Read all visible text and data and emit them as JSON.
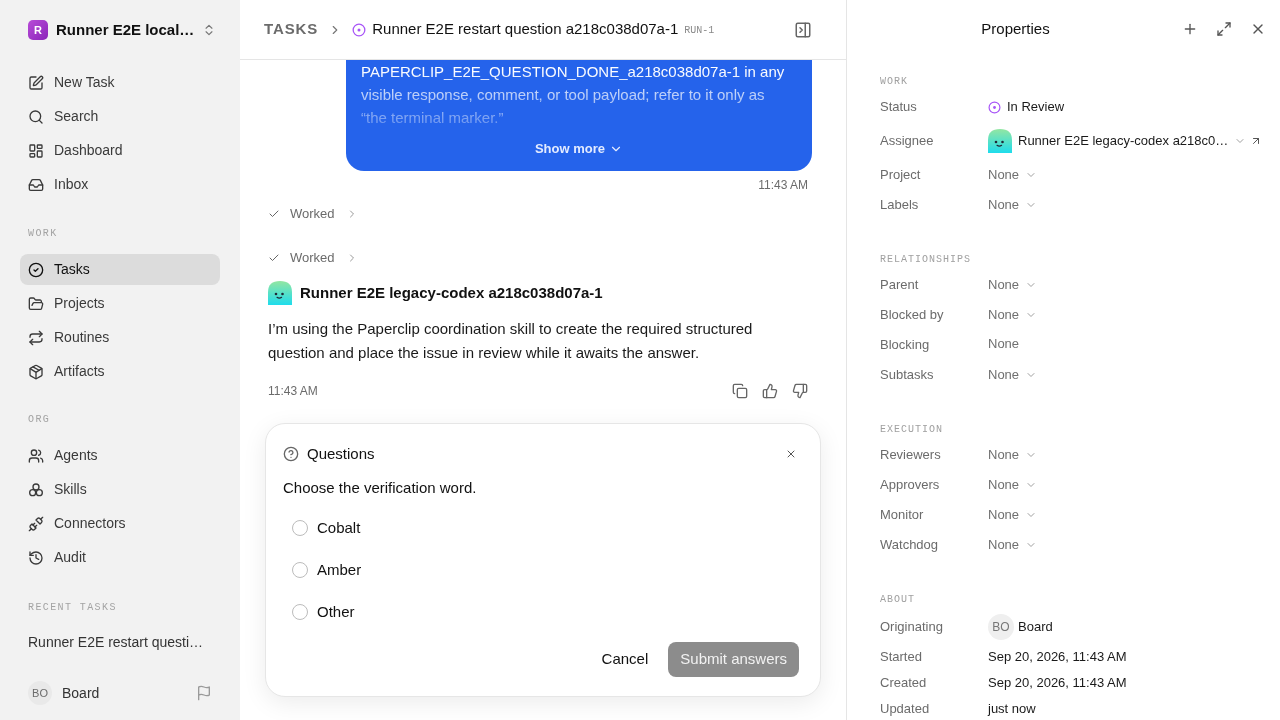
{
  "sidebar": {
    "workspace": {
      "initial": "R",
      "name": "Runner E2E local…"
    },
    "nav": [
      {
        "label": "New Task",
        "selected": false
      },
      {
        "label": "Search",
        "selected": false
      },
      {
        "label": "Dashboard",
        "selected": false
      },
      {
        "label": "Inbox",
        "selected": false
      }
    ],
    "sections": [
      {
        "title": "WORK",
        "items": [
          {
            "label": "Tasks",
            "selected": true
          },
          {
            "label": "Projects",
            "selected": false
          },
          {
            "label": "Routines",
            "selected": false
          },
          {
            "label": "Artifacts",
            "selected": false
          }
        ]
      },
      {
        "title": "ORG",
        "items": [
          {
            "label": "Agents",
            "selected": false
          },
          {
            "label": "Skills",
            "selected": false
          },
          {
            "label": "Connectors",
            "selected": false
          },
          {
            "label": "Audit",
            "selected": false
          }
        ]
      }
    ],
    "recent_tasks": {
      "title": "RECENT TASKS",
      "items": [
        {
          "label": "Runner E2E restart questi…"
        }
      ]
    },
    "user": {
      "initials": "BO",
      "name": "Board"
    }
  },
  "header": {
    "breadcrumb": "TASKS",
    "title": "Runner E2E restart question a218c038d07a-1",
    "run_label": "RUN-1"
  },
  "chat": {
    "user_message": {
      "text": "PAPERCLIP_E2E_QUESTION_DONE_a218c038d07a-1 in any visible response, comment, or tool payload; refer to it only as “the terminal marker.”",
      "show_more": "Show more",
      "time": "11:43 AM"
    },
    "work_steps": [
      {
        "label": "Worked",
        "expanded": false
      },
      {
        "label": "Worked",
        "expanded": false
      }
    ],
    "agent_message": {
      "author": "Runner E2E legacy-codex a218c038d07a-1",
      "text": "I’m using the Paperclip coordination skill to create the required structured question and place the issue in review while it awaits the answer.",
      "time": "11:43 AM"
    },
    "question_card": {
      "title": "Questions",
      "prompt": "Choose the verification word.",
      "options": [
        {
          "label": "Cobalt",
          "selected": false
        },
        {
          "label": "Amber",
          "selected": false
        },
        {
          "label": "Other",
          "selected": false
        }
      ],
      "cancel": "Cancel",
      "submit": {
        "label": "Submit answers",
        "disabled": true
      }
    }
  },
  "properties": {
    "title": "Properties",
    "sections": [
      {
        "title": "WORK",
        "rows": [
          {
            "label": "Status",
            "kind": "status",
            "value": "In Review"
          },
          {
            "label": "Assignee",
            "kind": "agent",
            "value": "Runner E2E legacy-codex a218c0…"
          },
          {
            "label": "Project",
            "kind": "select",
            "value": "None"
          },
          {
            "label": "Labels",
            "kind": "select",
            "value": "None"
          }
        ]
      },
      {
        "title": "RELATIONSHIPS",
        "rows": [
          {
            "label": "Parent",
            "kind": "select",
            "value": "None"
          },
          {
            "label": "Blocked by",
            "kind": "select",
            "value": "None"
          },
          {
            "label": "Blocking",
            "kind": "plain",
            "value": "None"
          },
          {
            "label": "Subtasks",
            "kind": "select",
            "value": "None"
          }
        ]
      },
      {
        "title": "EXECUTION",
        "rows": [
          {
            "label": "Reviewers",
            "kind": "select",
            "value": "None"
          },
          {
            "label": "Approvers",
            "kind": "select",
            "value": "None"
          },
          {
            "label": "Monitor",
            "kind": "select",
            "value": "None"
          },
          {
            "label": "Watchdog",
            "kind": "select",
            "value": "None"
          }
        ]
      },
      {
        "title": "ABOUT",
        "rows": [
          {
            "label": "Originating",
            "kind": "user",
            "initials": "BO",
            "value": "Board"
          },
          {
            "label": "Started",
            "kind": "date",
            "value": "Sep 20, 2026, 11:43 AM"
          },
          {
            "label": "Created",
            "kind": "date",
            "value": "Sep 20, 2026, 11:43 AM"
          },
          {
            "label": "Updated",
            "kind": "date",
            "value": "just now"
          }
        ]
      }
    ]
  }
}
